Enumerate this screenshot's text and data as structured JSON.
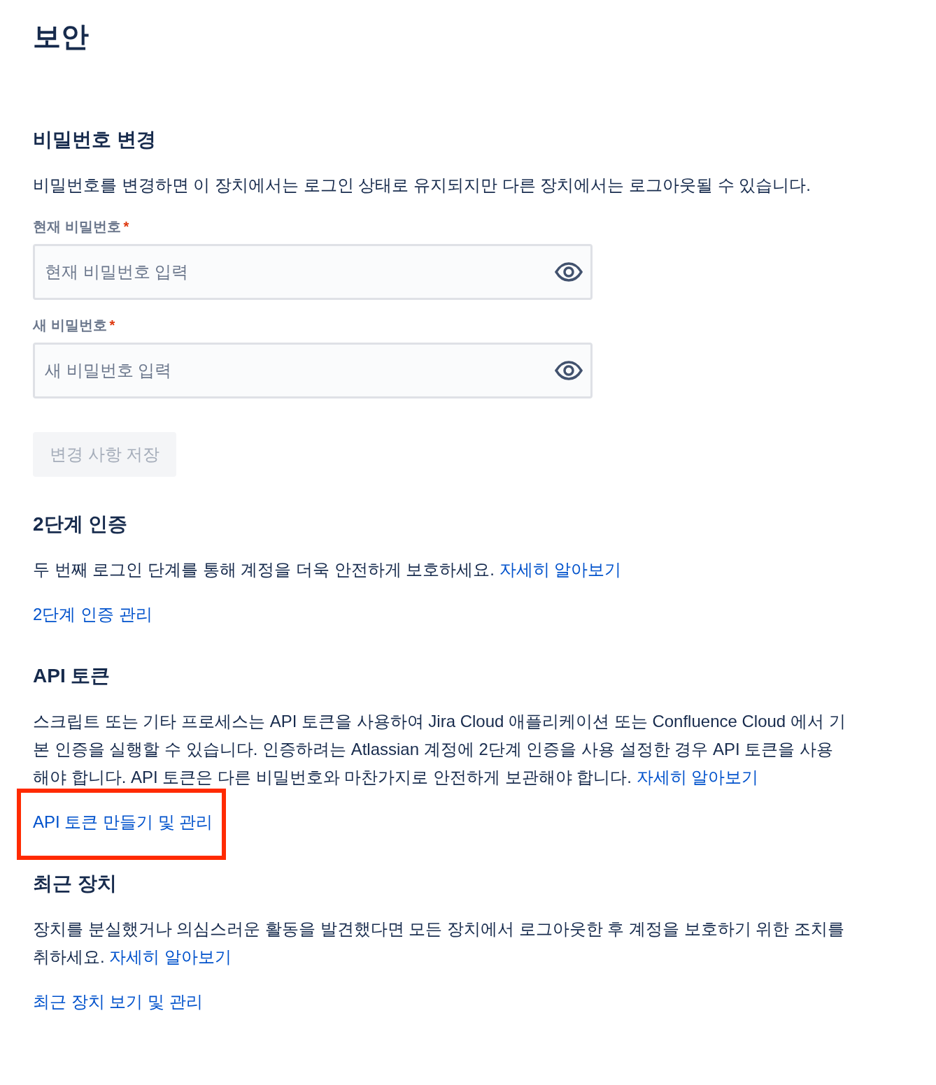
{
  "page_title": "보안",
  "sections": [
    {
      "kind": "password",
      "heading": "비밀번호 변경",
      "description": "비밀번호를 변경하면 이 장치에서는 로그인 상태로 유지되지만 다른 장치에서는 로그아웃될 수 있습니다.",
      "fields": [
        {
          "label": "현재 비밀번호",
          "required_mark": "*",
          "placeholder": "현재 비밀번호 입력"
        },
        {
          "label": "새 비밀번호",
          "required_mark": "*",
          "placeholder": "새 비밀번호 입력"
        }
      ],
      "button": {
        "label": "변경 사항 저장",
        "disabled": true
      }
    },
    {
      "kind": "links",
      "heading": "2단계 인증",
      "description": "두 번째 로그인 단계를 통해 계정을 더욱 안전하게 보호하세요.",
      "description_link": "자세히 알아보기",
      "action": {
        "label": "2단계 인증 관리",
        "highlighted": false
      }
    },
    {
      "kind": "links",
      "heading": "API 토큰",
      "description": "스크립트 또는 기타 프로세스는 API 토큰을 사용하여 Jira Cloud 애플리케이션 또는 Confluence Cloud 에서 기본 인증을 실행할 수 있습니다. 인증하려는 Atlassian 계정에 2단계 인증을 사용 설정한 경우 API 토큰을 사용해야 합니다. API 토큰은 다른 비밀번호와 마찬가지로 안전하게 보관해야 합니다.",
      "description_link": "자세히 알아보기",
      "action": {
        "label": "API 토큰 만들기 및 관리",
        "highlighted": true
      }
    },
    {
      "kind": "links",
      "heading": "최근 장치",
      "description": "장치를 분실했거나 의심스러운 활동을 발견했다면 모든 장치에서 로그아웃한 후 계정을 보호하기 위한 조치를 취하세요.",
      "description_link": "자세히 알아보기",
      "action": {
        "label": "최근 장치 보기 및 관리",
        "highlighted": false
      }
    }
  ]
}
